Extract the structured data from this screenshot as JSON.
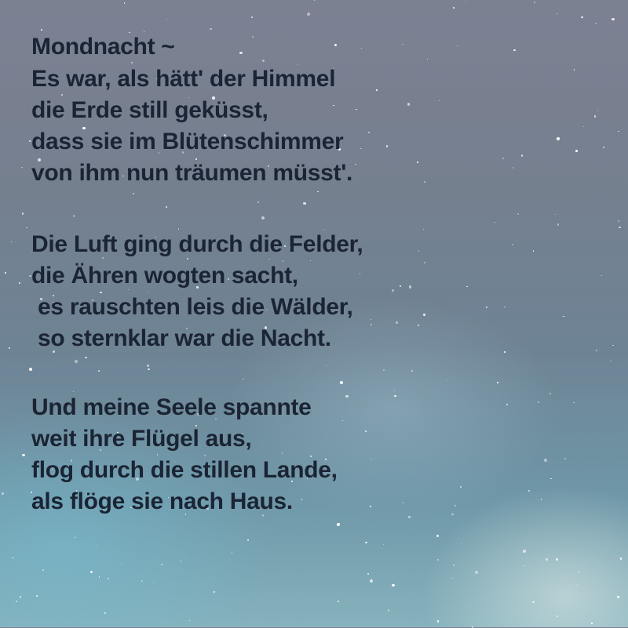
{
  "poem": {
    "title": "Mondnacht ~",
    "stanzas": [
      [
        "Es war, als hätt' der Himmel",
        "die Erde still geküsst,",
        "dass sie im Blütenschimmer",
        "von ihm nun träumen müsst'."
      ],
      [
        "Die Luft ging durch die Felder,",
        "die Ähren wogten sacht,",
        " es rauschten leis die Wälder,",
        " so sternklar war die Nacht."
      ],
      [
        "Und meine Seele spannte",
        "weit ihre Flügel aus,",
        "flog durch die stillen Lande,",
        "als flöge sie nach Haus."
      ]
    ]
  }
}
